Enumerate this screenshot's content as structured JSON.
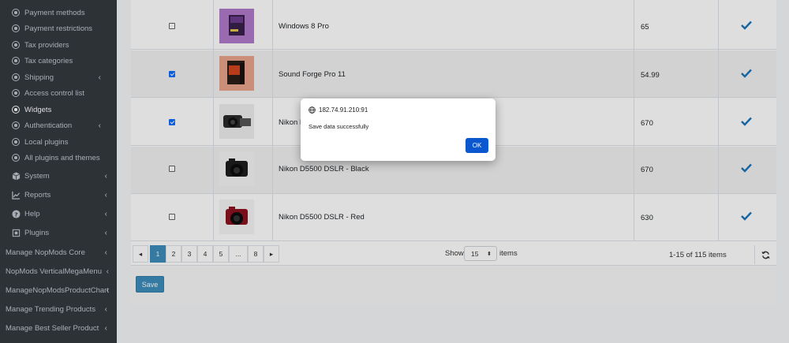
{
  "sidebar": {
    "sub_items": [
      {
        "label": "Payment methods"
      },
      {
        "label": "Payment restrictions"
      },
      {
        "label": "Tax providers"
      },
      {
        "label": "Tax categories"
      },
      {
        "label": "Shipping"
      },
      {
        "label": "Access control list"
      },
      {
        "label": "Widgets"
      },
      {
        "label": "Authentication"
      },
      {
        "label": "Local plugins"
      },
      {
        "label": "All plugins and themes"
      }
    ],
    "main_items": [
      {
        "label": "System",
        "icon": "cube-icon"
      },
      {
        "label": "Reports",
        "icon": "chart-icon"
      },
      {
        "label": "Help",
        "icon": "question-circle-icon"
      },
      {
        "label": "Plugins",
        "icon": "puzzle-icon"
      }
    ],
    "top_items": [
      {
        "label": "Manage NopMods Core"
      },
      {
        "label": "NopMods VerticalMegaMenu"
      },
      {
        "label": "ManageNopModsProductChart"
      },
      {
        "label": "Manage Trending Products"
      },
      {
        "label": "Manage Best Seller Product"
      }
    ]
  },
  "table": {
    "rows": [
      {
        "name": "Windows 8 Pro",
        "price": "65",
        "checked": false
      },
      {
        "name": "Sound Forge Pro 11",
        "price": "54.99",
        "checked": true
      },
      {
        "name": "Nikon D",
        "price": "670",
        "checked": true
      },
      {
        "name": "Nikon D5500 DSLR - Black",
        "price": "670",
        "checked": false
      },
      {
        "name": "Nikon D5500 DSLR - Red",
        "price": "630",
        "checked": false
      }
    ]
  },
  "pager": {
    "prev": "◂",
    "pages": [
      "1",
      "2",
      "3",
      "4",
      "5",
      "...",
      "8"
    ],
    "next": "▸",
    "show_label": "Show",
    "page_size": "15",
    "items_label": "items",
    "range": "1-15 of 115 items"
  },
  "actions": {
    "save_label": "Save"
  },
  "dialog": {
    "origin": "182.74.91.210:91",
    "message": "Save data successfully",
    "ok_label": "OK"
  },
  "colors": {
    "sidebar_bg": "#343a40",
    "accent": "#3c8dbc",
    "dialog_button": "#0b57d0",
    "check": "#1a73b8"
  }
}
